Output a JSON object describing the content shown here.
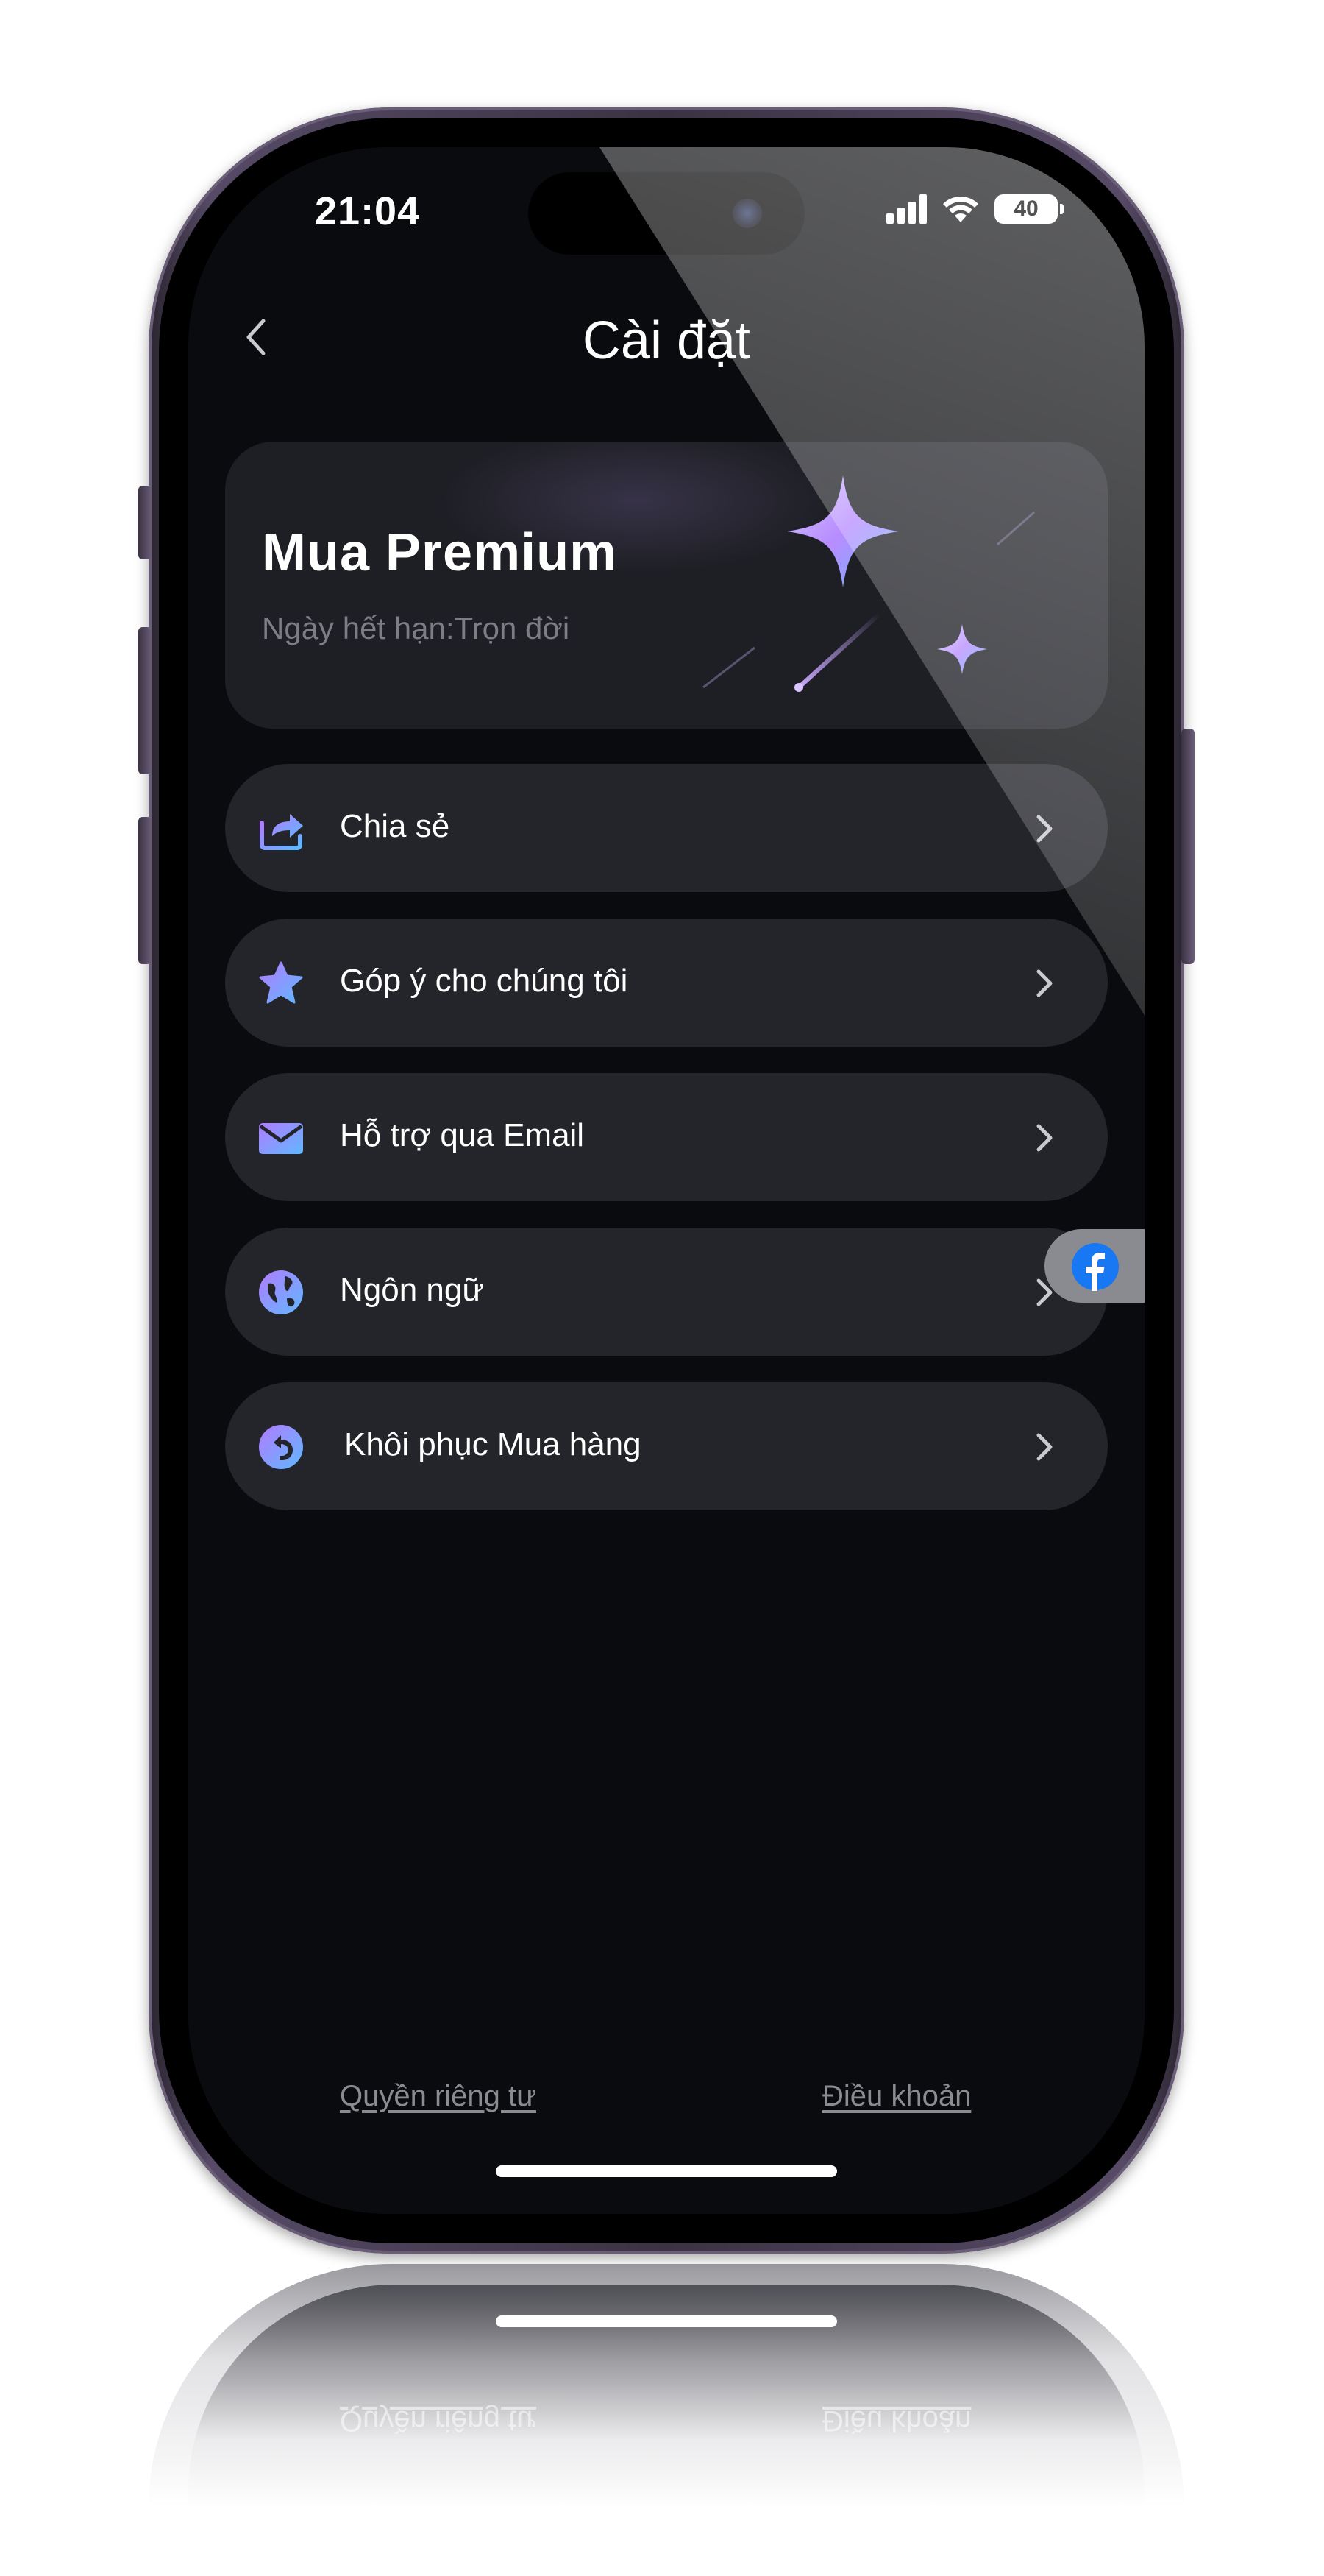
{
  "status_bar": {
    "time": "21:04",
    "battery": "40"
  },
  "header": {
    "title": "Cài đặt"
  },
  "premium": {
    "title": "Mua Premium",
    "subtitle": "Ngày hết hạn:Trọn đời"
  },
  "menu": {
    "items": [
      {
        "label": "Chia sẻ",
        "icon": "share-icon"
      },
      {
        "label": "Góp ý cho chúng tôi",
        "icon": "star-icon"
      },
      {
        "label": "Hỗ trợ qua Email",
        "icon": "mail-icon"
      },
      {
        "label": "Ngôn ngữ",
        "icon": "globe-icon"
      },
      {
        "label": "Khôi phục Mua hàng",
        "icon": "restore-icon"
      }
    ]
  },
  "footer": {
    "privacy": "Quyền riêng tư",
    "terms": "Điều khoản"
  },
  "colors": {
    "background": "#0a0b0e",
    "card": "#24252b",
    "accent_start": "#a77bff",
    "accent_end": "#5fb8ff"
  }
}
